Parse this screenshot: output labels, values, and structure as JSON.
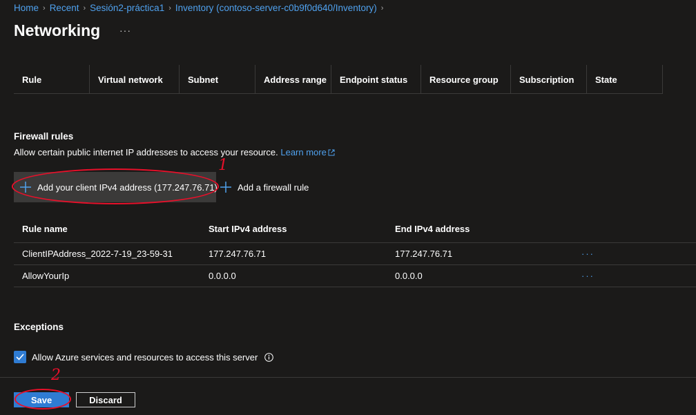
{
  "breadcrumb": {
    "items": [
      "Home",
      "Recent",
      "Sesión2-práctica1",
      "Inventory (contoso-server-c0b9f0d640/Inventory)"
    ],
    "separator": ">"
  },
  "page": {
    "title": "Networking",
    "more": "···"
  },
  "vnet_table": {
    "columns": [
      "Rule",
      "Virtual network",
      "Subnet",
      "Address range",
      "Endpoint status",
      "Resource group",
      "Subscription",
      "State"
    ]
  },
  "firewall": {
    "title": "Firewall rules",
    "description": "Allow certain public internet IP addresses to access your resource.",
    "learn_more": "Learn more",
    "add_client_label": "Add your client IPv4 address (177.247.76.71)",
    "add_rule_label": "Add a firewall rule",
    "columns": [
      "Rule name",
      "Start IPv4 address",
      "End IPv4 address"
    ],
    "rows": [
      {
        "name": "ClientIPAddress_2022-7-19_23-59-31",
        "start": "177.247.76.71",
        "end": "177.247.76.71",
        "more": "···"
      },
      {
        "name": "AllowYourIp",
        "start": "0.0.0.0",
        "end": "0.0.0.0",
        "more": "···"
      }
    ]
  },
  "exceptions": {
    "title": "Exceptions",
    "allow_azure_label": "Allow Azure services and resources to access this server",
    "allow_azure_checked": true
  },
  "footer": {
    "save_label": "Save",
    "discard_label": "Discard"
  },
  "annotations": {
    "marker_1": "1",
    "marker_2": "2"
  },
  "colors": {
    "background": "#1b1a19",
    "link": "#4fa1ee",
    "primary": "#2f7cd3",
    "annotation": "#e8102a",
    "divider": "#3b3a39"
  },
  "icons": {
    "plus": "plus-icon",
    "external_link": "external-link-icon",
    "info": "info-icon",
    "check": "checkmark-icon",
    "chevron": "chevron-right-icon"
  }
}
